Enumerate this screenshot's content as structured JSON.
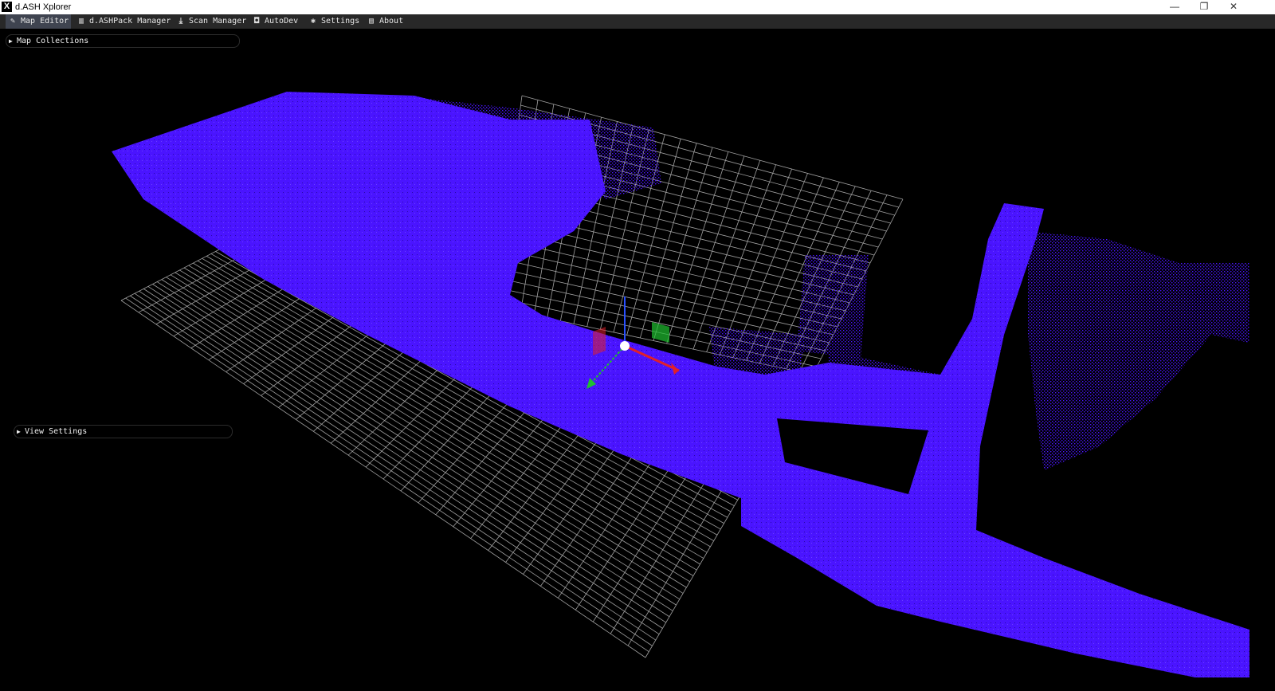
{
  "window": {
    "title": "d.ASH Xplorer",
    "icon_letter": "X",
    "controls": {
      "minimize": "—",
      "restore": "❐",
      "close": "✕"
    }
  },
  "menu": {
    "items": [
      {
        "label": "Map Editor",
        "icon": "edit-icon",
        "glyph": "✎",
        "active": true
      },
      {
        "label": "d.ASHPack Manager",
        "icon": "map-icon",
        "glyph": "▥",
        "active": false
      },
      {
        "label": "Scan Manager",
        "icon": "download-icon",
        "glyph": "⤓",
        "active": false
      },
      {
        "label": "AutoDev",
        "icon": "robot-icon",
        "glyph": "◘",
        "active": false
      },
      {
        "label": "Settings",
        "icon": "gear-icon",
        "glyph": "✱",
        "active": false
      },
      {
        "label": "About",
        "icon": "id-card-icon",
        "glyph": "▤",
        "active": false
      }
    ]
  },
  "panels": {
    "map_collections": {
      "label": "Map Collections",
      "arrow": "▶"
    },
    "view_settings": {
      "label": "View Settings",
      "arrow": "▶"
    }
  },
  "colors": {
    "point_cloud": "#4a14ff",
    "grid": "#bdbdbd",
    "axis_x": "#e0202a",
    "axis_y": "#20c030",
    "axis_z": "#2a50ff",
    "background": "#000000",
    "menubar": "#282828"
  }
}
